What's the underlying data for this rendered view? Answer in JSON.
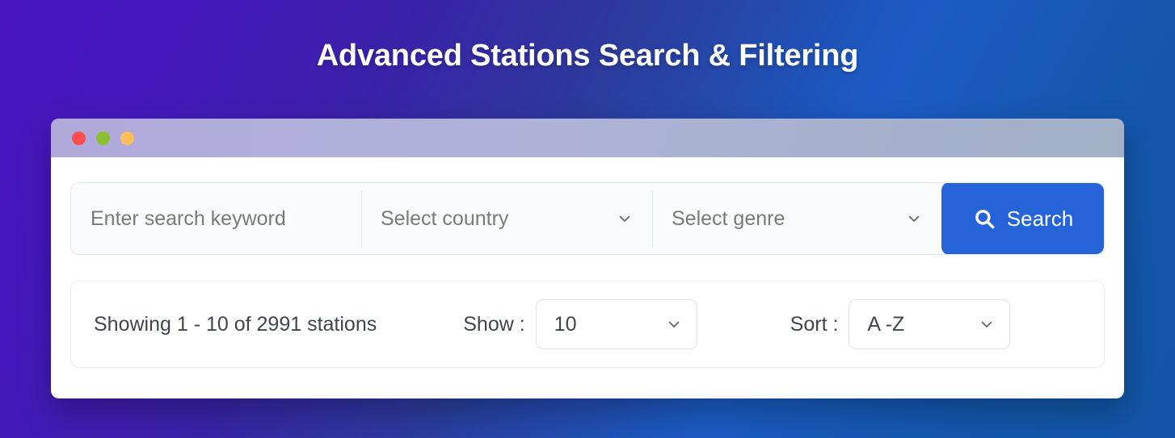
{
  "page": {
    "title": "Advanced Stations Search & Filtering"
  },
  "window": {
    "traffic_lights": [
      {
        "name": "close",
        "color": "#ff4d4d"
      },
      {
        "name": "minimize",
        "color": "#8cc02e"
      },
      {
        "name": "maximize",
        "color": "#ffbe5c"
      }
    ]
  },
  "search": {
    "keyword_placeholder": "Enter search keyword",
    "country_placeholder": "Select country",
    "genre_placeholder": "Select genre",
    "button_label": "Search",
    "button_color": "#2563d9",
    "search_icon": "search-icon",
    "chevron_icon": "chevron-down-icon"
  },
  "results": {
    "showing_text": "Showing 1 - 10 of 2991 stations",
    "show_label": "Show :",
    "show_value": "10",
    "sort_label": "Sort :",
    "sort_value": "A -Z"
  }
}
